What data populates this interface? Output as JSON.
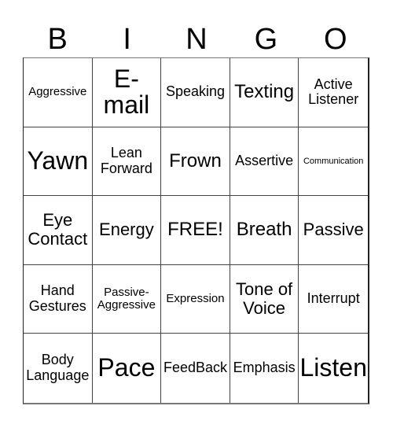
{
  "header": {
    "letters": [
      "B",
      "I",
      "N",
      "G",
      "O"
    ]
  },
  "cells": [
    {
      "text": "Aggressive",
      "size": "s-sm"
    },
    {
      "text": "E-\nmail",
      "size": "s-xxl"
    },
    {
      "text": "Speaking",
      "size": "s-md"
    },
    {
      "text": "Texting",
      "size": "s-xl"
    },
    {
      "text": "Active\nListener",
      "size": "s-md"
    },
    {
      "text": "Yawn",
      "size": "s-xxl"
    },
    {
      "text": "Lean\nForward",
      "size": "s-md"
    },
    {
      "text": "Frown",
      "size": "s-xl"
    },
    {
      "text": "Assertive",
      "size": "s-md"
    },
    {
      "text": "Communication",
      "size": "s-xs"
    },
    {
      "text": "Eye\nContact",
      "size": "s-lg"
    },
    {
      "text": "Energy",
      "size": "s-lg"
    },
    {
      "text": "FREE!",
      "size": "s-xl"
    },
    {
      "text": "Breath",
      "size": "s-xl"
    },
    {
      "text": "Passive",
      "size": "s-lg"
    },
    {
      "text": "Hand\nGestures",
      "size": "s-md"
    },
    {
      "text": "Passive-\nAggressive",
      "size": "s-sm"
    },
    {
      "text": "Expression",
      "size": "s-sm"
    },
    {
      "text": "Tone of\nVoice",
      "size": "s-lg"
    },
    {
      "text": "Interrupt",
      "size": "s-md"
    },
    {
      "text": "Body\nLanguage",
      "size": "s-md"
    },
    {
      "text": "Pace",
      "size": "s-xxl"
    },
    {
      "text": "FeedBack",
      "size": "s-md"
    },
    {
      "text": "Emphasis",
      "size": "s-md"
    },
    {
      "text": "Listen",
      "size": "s-xxl"
    }
  ]
}
